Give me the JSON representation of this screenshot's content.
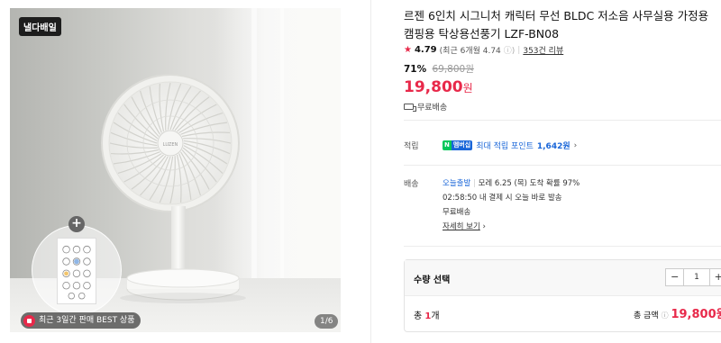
{
  "gallery": {
    "badge": "낼다배일",
    "best_label": "최근 3일간 판매 BEST 상품",
    "page_indicator": "1/6",
    "fan_logo": "LUZEN"
  },
  "product": {
    "title_line1": "르젠 6인치 시그니처 캐릭터 무선 BLDC 저소음 사무실용 가정용",
    "title_line2": "캠핑용 탁상용선풍기 LZF-BN08",
    "rating_score": "4.79",
    "rating_recent": "(최근 6개월 4.74",
    "rating_info_icon": "info-icon",
    "review_link": "353건 리뷰",
    "discount_rate": "71%",
    "original_price": "69,800원",
    "sale_price": "19,800",
    "sale_currency": "원",
    "shipping_label": "무료배송"
  },
  "points": {
    "label": "적립",
    "badge_n": "N",
    "badge_m": "멤버십",
    "text": "최대 적립 포인트",
    "amount": "1,642원",
    "chevron": "›"
  },
  "delivery": {
    "label": "배송",
    "today_tag": "오늘출발",
    "eta": "모레 6.25 (목) 도착 확률 97%",
    "cutoff": "02:58:50  내 결제 시 오늘 바로 발송",
    "fee": "무료배송",
    "detail_link": "자세히 보기",
    "chevron": "›"
  },
  "order": {
    "qty_label": "수량 선택",
    "minus": "−",
    "qty_value": "1",
    "plus": "+",
    "total_count_prefix": "총",
    "total_count": "1",
    "total_count_suffix": "개",
    "total_label": "총 금액",
    "total_amount": "19,800원"
  },
  "colors": {
    "accent_red": "#e8294a",
    "link_blue": "#1a66d8",
    "naver_green": "#03c75a"
  }
}
